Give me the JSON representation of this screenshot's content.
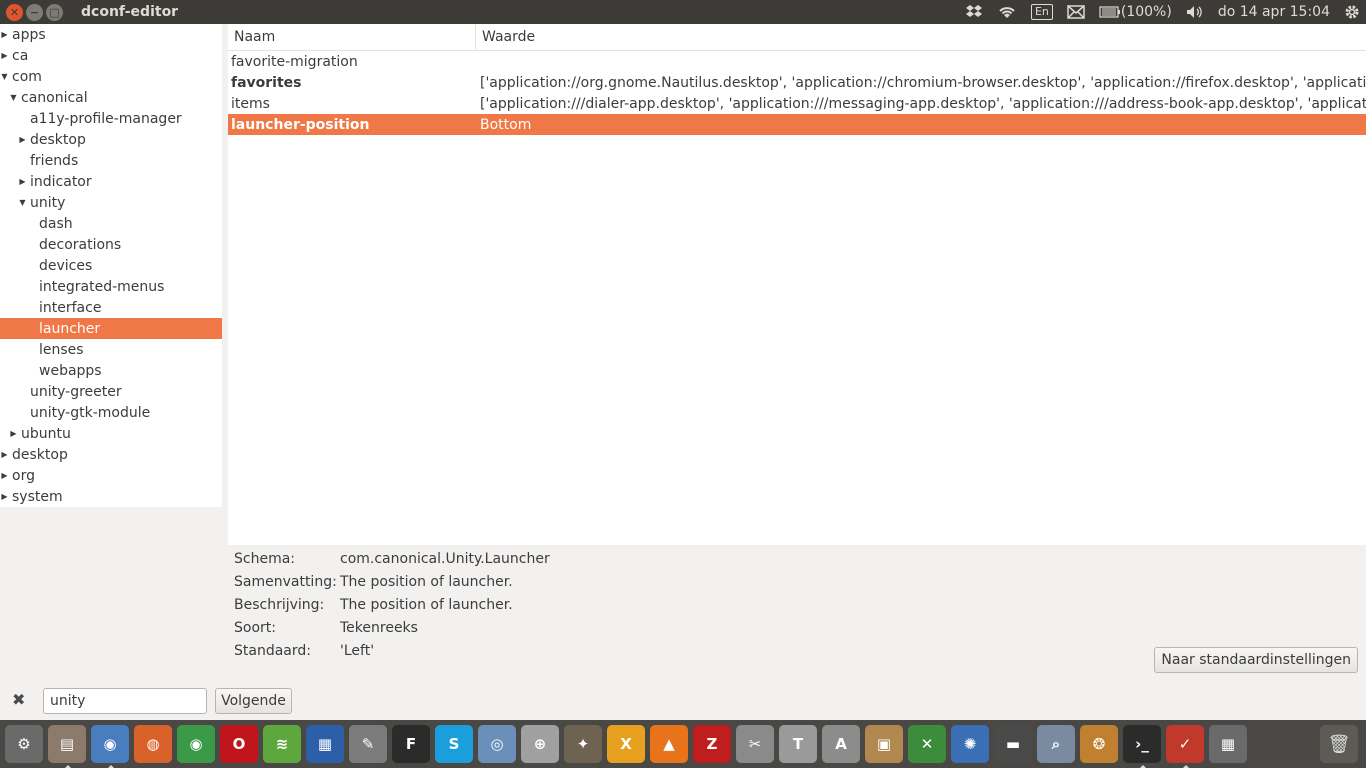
{
  "window": {
    "title": "dconf-editor"
  },
  "panel": {
    "keyboard_layout": "En",
    "battery": "(100%)",
    "datetime": "do 14 apr 15:04"
  },
  "tree": [
    {
      "label": "apps",
      "depth": 0,
      "expander": "collapsed"
    },
    {
      "label": "ca",
      "depth": 0,
      "expander": "collapsed"
    },
    {
      "label": "com",
      "depth": 0,
      "expander": "expanded"
    },
    {
      "label": "canonical",
      "depth": 1,
      "expander": "expanded"
    },
    {
      "label": "a11y-profile-manager",
      "depth": 2,
      "expander": "none"
    },
    {
      "label": "desktop",
      "depth": 2,
      "expander": "collapsed"
    },
    {
      "label": "friends",
      "depth": 2,
      "expander": "none"
    },
    {
      "label": "indicator",
      "depth": 2,
      "expander": "collapsed"
    },
    {
      "label": "unity",
      "depth": 2,
      "expander": "expanded"
    },
    {
      "label": "dash",
      "depth": 3,
      "expander": "none"
    },
    {
      "label": "decorations",
      "depth": 3,
      "expander": "none"
    },
    {
      "label": "devices",
      "depth": 3,
      "expander": "none"
    },
    {
      "label": "integrated-menus",
      "depth": 3,
      "expander": "none"
    },
    {
      "label": "interface",
      "depth": 3,
      "expander": "none"
    },
    {
      "label": "launcher",
      "depth": 3,
      "expander": "none",
      "selected": true
    },
    {
      "label": "lenses",
      "depth": 3,
      "expander": "none"
    },
    {
      "label": "webapps",
      "depth": 3,
      "expander": "none"
    },
    {
      "label": "unity-greeter",
      "depth": 2,
      "expander": "none"
    },
    {
      "label": "unity-gtk-module",
      "depth": 2,
      "expander": "none"
    },
    {
      "label": "ubuntu",
      "depth": 1,
      "expander": "collapsed"
    },
    {
      "label": "desktop",
      "depth": 0,
      "expander": "collapsed"
    },
    {
      "label": "org",
      "depth": 0,
      "expander": "collapsed"
    },
    {
      "label": "system",
      "depth": 0,
      "expander": "collapsed"
    }
  ],
  "keys": {
    "col_name": "Naam",
    "col_value": "Waarde",
    "rows": [
      {
        "name": "favorite-migration",
        "value": "",
        "bold": false
      },
      {
        "name": "favorites",
        "value": "['application://org.gnome.Nautilus.desktop', 'application://chromium-browser.desktop', 'application://firefox.desktop', 'applicati",
        "bold": true
      },
      {
        "name": "items",
        "value": "['application:///dialer-app.desktop', 'application:///messaging-app.desktop', 'application:///address-book-app.desktop', 'applicati",
        "bold": false
      },
      {
        "name": "launcher-position",
        "value": "Bottom",
        "bold": true,
        "selected": true
      }
    ]
  },
  "details": {
    "schema_label": "Schema:",
    "schema_value": "com.canonical.Unity.Launcher",
    "summary_label": "Samenvatting:",
    "summary_value": "The position of launcher.",
    "description_label": "Beschrijving:",
    "description_value": "The position of launcher.",
    "type_label": "Soort:",
    "type_value": "Tekenreeks",
    "default_label": "Standaard:",
    "default_value": "'Left'",
    "reset_button": "Naar standaardinstellingen"
  },
  "search": {
    "value": "unity",
    "next_button": "Volgende"
  },
  "launcher": {
    "icons": [
      {
        "name": "system-settings-icon",
        "glyph": "⚙",
        "color": "#6a6a6a"
      },
      {
        "name": "files-icon",
        "glyph": "▤",
        "color": "#8c7a6a",
        "active": true
      },
      {
        "name": "chromium-icon",
        "glyph": "◉",
        "color": "#4a7cc0",
        "active": true
      },
      {
        "name": "firefox-icon",
        "glyph": "◍",
        "color": "#d9622b"
      },
      {
        "name": "chrome-icon",
        "glyph": "◉",
        "color": "#3b9a48"
      },
      {
        "name": "opera-icon",
        "glyph": "O",
        "color": "#c0151d"
      },
      {
        "name": "spotify-icon",
        "glyph": "≋",
        "color": "#5ea73c"
      },
      {
        "name": "writer-icon",
        "glyph": "▦",
        "color": "#2c5fa8"
      },
      {
        "name": "text-editor-icon",
        "glyph": "✎",
        "color": "#7c7c7c"
      },
      {
        "name": "font-viewer-icon",
        "glyph": "F",
        "color": "#2b2b2b"
      },
      {
        "name": "skype-icon",
        "glyph": "S",
        "color": "#1a9fdc"
      },
      {
        "name": "network-icon",
        "glyph": "◎",
        "color": "#6a8fb8"
      },
      {
        "name": "software-center-icon",
        "glyph": "⊕",
        "color": "#a0a0a0"
      },
      {
        "name": "gimp-icon",
        "glyph": "✦",
        "color": "#6d6350"
      },
      {
        "name": "xchat-icon",
        "glyph": "X",
        "color": "#e8a020"
      },
      {
        "name": "vlc-icon",
        "glyph": "▲",
        "color": "#e9731b"
      },
      {
        "name": "filezilla-icon",
        "glyph": "Z",
        "color": "#c01d1d"
      },
      {
        "name": "screenshot-icon",
        "glyph": "✂",
        "color": "#8a8a8a"
      },
      {
        "name": "tex-icon",
        "glyph": "T",
        "color": "#9a9a9a"
      },
      {
        "name": "ab-icon",
        "glyph": "A",
        "color": "#8c8c8c"
      },
      {
        "name": "photos-icon",
        "glyph": "▣",
        "color": "#b08850"
      },
      {
        "name": "pencil-icon",
        "glyph": "✕",
        "color": "#3b8c3b"
      },
      {
        "name": "atom-icon",
        "glyph": "✺",
        "color": "#3a6fb5"
      },
      {
        "name": "clapper-icon",
        "glyph": "▬",
        "color": "#4a4a4a"
      },
      {
        "name": "magnifier-icon",
        "glyph": "⌕",
        "color": "#7a8aa0"
      },
      {
        "name": "aperture-icon",
        "glyph": "❂",
        "color": "#c08030"
      },
      {
        "name": "terminal-icon",
        "glyph": "›_",
        "color": "#2b2b2b",
        "active": true
      },
      {
        "name": "checkmark-app-icon",
        "glyph": "✓",
        "color": "#c0392b",
        "active": true
      },
      {
        "name": "workspaces-icon",
        "glyph": "▦",
        "color": "#6a6a6a"
      }
    ]
  }
}
